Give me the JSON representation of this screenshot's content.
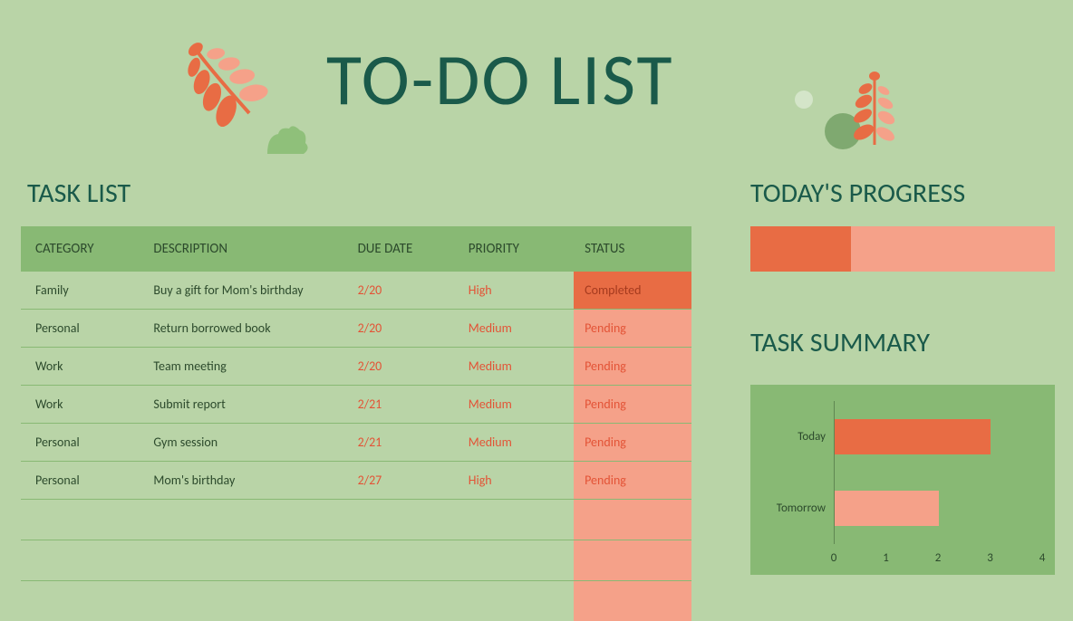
{
  "title": "TO-DO LIST",
  "headings": {
    "task_list": "TASK LIST",
    "progress": "TODAY'S PROGRESS",
    "summary": "TASK SUMMARY"
  },
  "columns": {
    "category": "CATEGORY",
    "description": "DESCRIPTION",
    "due": "DUE DATE",
    "priority": "PRIORITY",
    "status": "STATUS"
  },
  "tasks": [
    {
      "category": "Family",
      "description": "Buy a gift for Mom's birthday",
      "due": "2/20",
      "priority": "High",
      "status": "Completed",
      "done": true
    },
    {
      "category": "Personal",
      "description": "Return borrowed book",
      "due": "2/20",
      "priority": "Medium",
      "status": "Pending",
      "done": false
    },
    {
      "category": "Work",
      "description": "Team meeting",
      "due": "2/20",
      "priority": "Medium",
      "status": "Pending",
      "done": false
    },
    {
      "category": "Work",
      "description": "Submit report",
      "due": "2/21",
      "priority": "Medium",
      "status": "Pending",
      "done": false
    },
    {
      "category": "Personal",
      "description": "Gym session",
      "due": "2/21",
      "priority": "Medium",
      "status": "Pending",
      "done": false
    },
    {
      "category": "Personal",
      "description": "Mom's birthday",
      "due": "2/27",
      "priority": "High",
      "status": "Pending",
      "done": false
    }
  ],
  "progress": {
    "percent": 33
  },
  "chart_data": {
    "type": "bar",
    "orientation": "horizontal",
    "categories": [
      "Today",
      "Tomorrow"
    ],
    "values": [
      3,
      2
    ],
    "colors": [
      "#e86c44",
      "#f5a189"
    ],
    "xlim": [
      0,
      4
    ],
    "xticks": [
      0,
      1,
      2,
      3,
      4
    ]
  }
}
